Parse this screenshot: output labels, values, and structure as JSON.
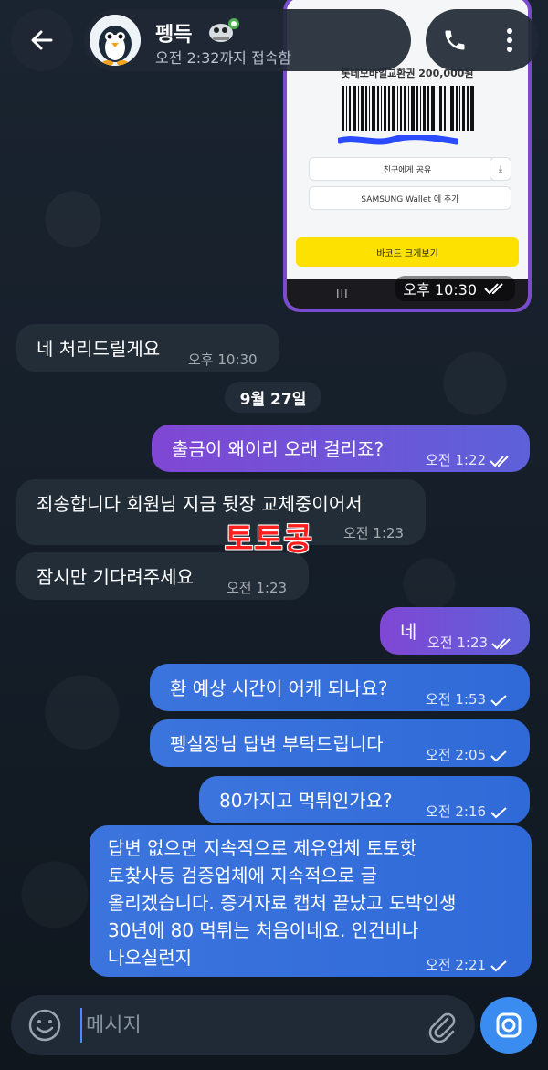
{
  "header": {
    "chat_name": "펭득",
    "status": "오전 2:32까지 접속함",
    "icons": {
      "back": "arrow-left-icon",
      "avatar": "penguin-avatar",
      "badge": "penguin-sticker-icon",
      "call": "phone-icon",
      "more": "more-vertical-icon"
    }
  },
  "image_message": {
    "voucher_title": "롯데모바일교환권 200,000원",
    "share_button": "친구에게 공유",
    "samsung_button": "SAMSUNG Wallet 에 추가",
    "barcode_button": "바코드 크게보기",
    "nav_lines": "III",
    "time": "오후 10:30"
  },
  "messages": [
    {
      "dir": "in",
      "text": "네 처리드릴게요",
      "time": "오후 10:30"
    },
    {
      "dir": "out",
      "text": "출금이 왜이리 오래 걸리죠?",
      "time": "오전 1:22",
      "status": "read"
    },
    {
      "dir": "in",
      "text": "죄송합니다 회원님 지금 뒷장 교체중이어서",
      "time": "오전 1:23"
    },
    {
      "dir": "in",
      "text": "잠시만 기다려주세요",
      "time": "오전 1:23"
    },
    {
      "dir": "out",
      "text": "네",
      "time": "오전 1:23",
      "status": "read"
    },
    {
      "dir": "out",
      "text": "환 예상 시간이 어케 되나요?",
      "time": "오전 1:53",
      "status": "sent"
    },
    {
      "dir": "out",
      "text": "펭실장님 답변 부탁드립니다",
      "time": "오전 2:05",
      "status": "sent"
    },
    {
      "dir": "out",
      "text": "80가지고 먹튀인가요?",
      "time": "오전 2:16",
      "status": "sent"
    },
    {
      "dir": "out",
      "lines": [
        "답변 없으면 지속적으로 제유업체 토토핫",
        "토찾사등 검증업체에 지속적으로 글",
        "올리겠습니다. 증거자료 캡처 끝났고 도박인생",
        "30년에 80 먹튀는 처음이네요. 인건비나",
        "나오실런지"
      ],
      "time": "오전 2:21",
      "status": "sent"
    }
  ],
  "date_divider": "9월 27일",
  "watermark": "토토콩",
  "composer": {
    "placeholder": "메시지",
    "icons": {
      "emoji": "smiley-icon",
      "attach": "paperclip-icon",
      "camera": "camera-icon"
    }
  },
  "colors": {
    "background": "#141d27",
    "incoming_bubble": "#222d38",
    "outgoing_purple": "#7a4bd6",
    "outgoing_blue": "#3570db",
    "accent": "#3a8cf0",
    "watermark": "#ff1e1e"
  }
}
